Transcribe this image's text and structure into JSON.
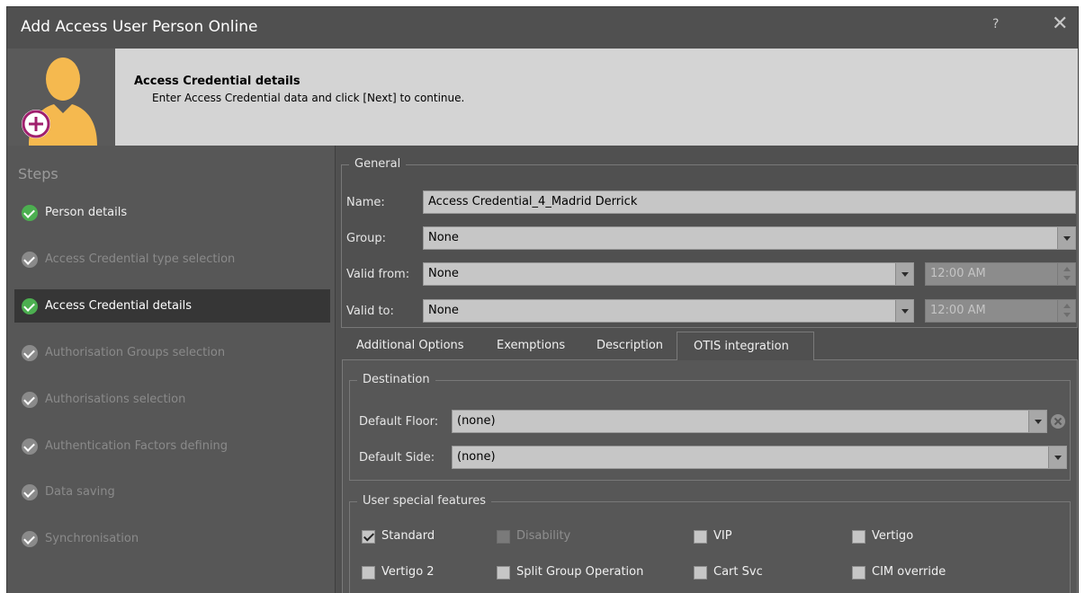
{
  "window": {
    "title": "Add Access User Person Online",
    "help_label": "?",
    "close_label": "✕"
  },
  "header": {
    "title": "Access Credential details",
    "subtitle": "Enter Access Credential data and click [Next] to continue."
  },
  "steps": {
    "title": "Steps",
    "items": [
      {
        "label": "Person details",
        "state": "done"
      },
      {
        "label": "Access Credential type selection",
        "state": "pending"
      },
      {
        "label": "Access Credential details",
        "state": "active"
      },
      {
        "label": "Authorisation Groups selection",
        "state": "pending"
      },
      {
        "label": "Authorisations selection",
        "state": "pending"
      },
      {
        "label": "Authentication Factors defining",
        "state": "pending"
      },
      {
        "label": "Data saving",
        "state": "pending"
      },
      {
        "label": "Synchronisation",
        "state": "pending"
      }
    ]
  },
  "general": {
    "legend": "General",
    "name_label": "Name:",
    "name_value": "Access Credential_4_Madrid Derrick",
    "group_label": "Group:",
    "group_value": "None",
    "valid_from_label": "Valid from:",
    "valid_from_value": "None",
    "valid_from_time": "12:00 AM",
    "valid_to_label": "Valid to:",
    "valid_to_value": "None",
    "valid_to_time": "12:00 AM"
  },
  "tabs": [
    {
      "label": "Additional Options"
    },
    {
      "label": "Exemptions"
    },
    {
      "label": "Description"
    },
    {
      "label": "OTIS integration",
      "active": true
    }
  ],
  "destination": {
    "legend": "Destination",
    "floor_label": "Default Floor:",
    "floor_value": "(none)",
    "side_label": "Default Side:",
    "side_value": "(none)"
  },
  "features": {
    "legend": "User special features",
    "items": [
      {
        "label": "Standard",
        "checked": true,
        "disabled": false
      },
      {
        "label": "Disability",
        "checked": false,
        "disabled": true
      },
      {
        "label": "VIP",
        "checked": false,
        "disabled": false
      },
      {
        "label": "Vertigo",
        "checked": false,
        "disabled": false
      },
      {
        "label": "Vertigo 2",
        "checked": false,
        "disabled": false
      },
      {
        "label": "Split Group Operation",
        "checked": false,
        "disabled": false
      },
      {
        "label": "Cart Svc",
        "checked": false,
        "disabled": false
      },
      {
        "label": "CIM override",
        "checked": false,
        "disabled": false
      }
    ]
  },
  "colors": {
    "accent_check": "#4caf50",
    "avatar": "#f5b94f",
    "add_badge": "#a0206e"
  }
}
